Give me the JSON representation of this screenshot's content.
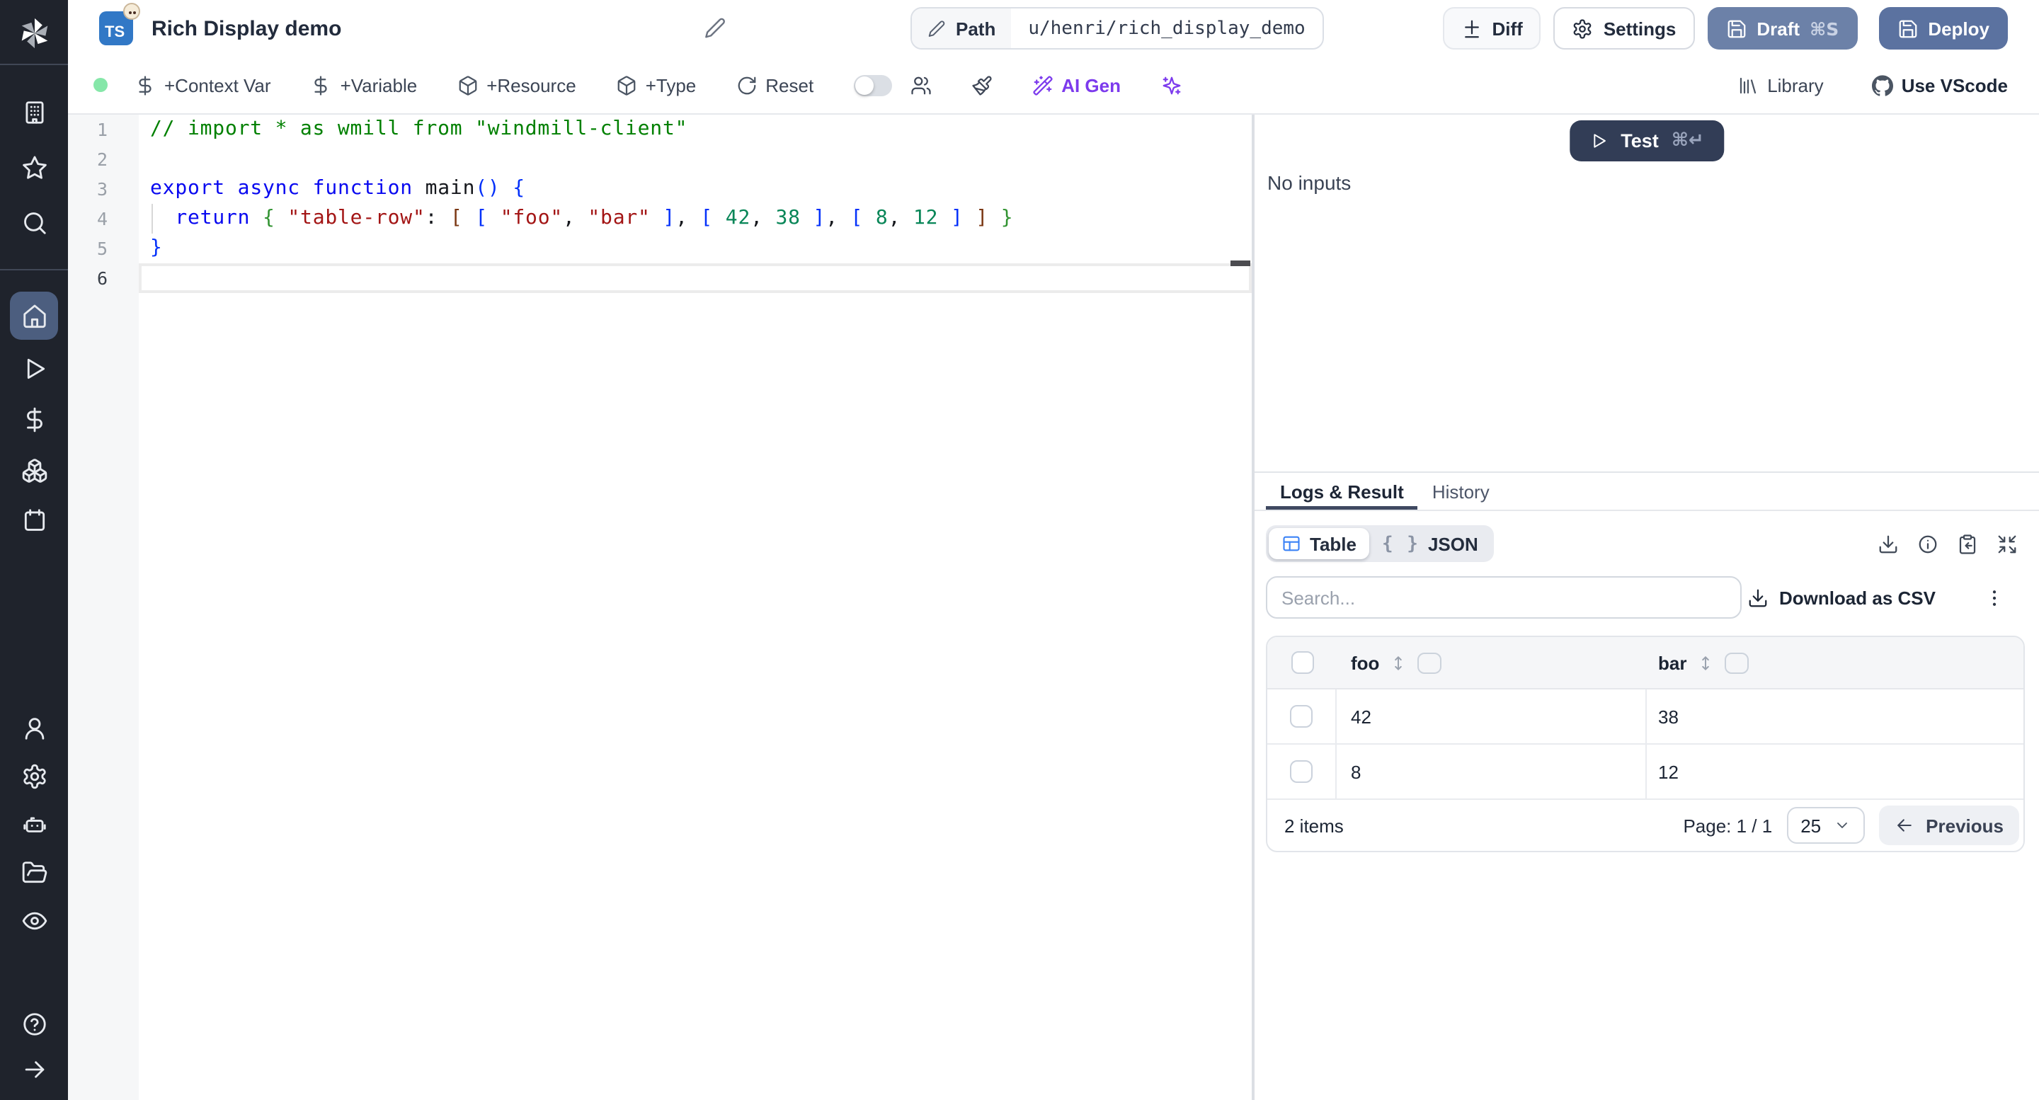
{
  "colors": {
    "sidebar_bg": "#1f232c",
    "active_nav_bg": "#4c5e7f",
    "draft_bg": "#6c81a8",
    "deploy_bg": "#5b72a0",
    "test_bg": "#323d56",
    "green_dot": "#86e7a9",
    "accent_purple": "#7c3aed",
    "table_icon_blue": "#3b82f6"
  },
  "icons_used": [
    "windmill-logo-icon",
    "building-icon",
    "star-icon",
    "search-icon",
    "home-icon",
    "play-icon",
    "dollar-icon",
    "boxes-icon",
    "calendar-icon",
    "user-icon",
    "gear-icon",
    "robot-icon",
    "folder-open-icon",
    "eye-icon",
    "help-icon",
    "arrow-right-icon",
    "pencil-icon",
    "diff-icon",
    "save-icon",
    "package-icon",
    "rotate-cw-icon",
    "users-icon",
    "paintbrush-icon",
    "wand-icon",
    "sparkles-icon",
    "library-icon",
    "github-icon",
    "table-icon",
    "braces-glyph",
    "download-icon",
    "info-icon",
    "clipboard-copy-icon",
    "expand-icon",
    "kebab-icon",
    "sort-icon",
    "chevron-down-icon",
    "arrow-left-icon"
  ],
  "header": {
    "badge": "TS",
    "title": "Rich Display demo",
    "path": {
      "label": "Path",
      "value": "u/henri/rich_display_demo"
    },
    "buttons": {
      "diff": "Diff",
      "settings": "Settings",
      "draft": "Draft",
      "draft_shortcut": "⌘S",
      "deploy": "Deploy"
    }
  },
  "toolbar": {
    "add_context_var": "+Context Var",
    "add_variable": "+Variable",
    "add_resource": "+Resource",
    "add_type": "+Type",
    "reset": "Reset",
    "ai_gen": "AI Gen",
    "library": "Library",
    "use_vscode": "Use VScode"
  },
  "editor": {
    "lines": [
      {
        "num": "1",
        "tokens": [
          [
            "comment",
            "// import * as wmill from \"windmill-client\""
          ]
        ]
      },
      {
        "num": "2",
        "tokens": []
      },
      {
        "num": "3",
        "tokens": [
          [
            "kw",
            "export"
          ],
          [
            "plain",
            " "
          ],
          [
            "kw",
            "async"
          ],
          [
            "plain",
            " "
          ],
          [
            "kw",
            "function"
          ],
          [
            "plain",
            " main"
          ],
          [
            "b1",
            "()"
          ],
          [
            "plain",
            " "
          ],
          [
            "b1",
            "{"
          ]
        ]
      },
      {
        "num": "4",
        "tokens": [
          [
            "plain",
            "  "
          ],
          [
            "kw",
            "return"
          ],
          [
            "plain",
            " "
          ],
          [
            "b2",
            "{"
          ],
          [
            "plain",
            " "
          ],
          [
            "str",
            "\"table-row\""
          ],
          [
            "plain",
            ": "
          ],
          [
            "b3",
            "["
          ],
          [
            "plain",
            " "
          ],
          [
            "b1",
            "["
          ],
          [
            "plain",
            " "
          ],
          [
            "str",
            "\"foo\""
          ],
          [
            "plain",
            ", "
          ],
          [
            "str",
            "\"bar\""
          ],
          [
            "plain",
            " "
          ],
          [
            "b1",
            "]"
          ],
          [
            "plain",
            ", "
          ],
          [
            "b1",
            "["
          ],
          [
            "plain",
            " "
          ],
          [
            "num",
            "42"
          ],
          [
            "plain",
            ", "
          ],
          [
            "num",
            "38"
          ],
          [
            "plain",
            " "
          ],
          [
            "b1",
            "]"
          ],
          [
            "plain",
            ", "
          ],
          [
            "b1",
            "["
          ],
          [
            "plain",
            " "
          ],
          [
            "num",
            "8"
          ],
          [
            "plain",
            ", "
          ],
          [
            "num",
            "12"
          ],
          [
            "plain",
            " "
          ],
          [
            "b1",
            "]"
          ],
          [
            "plain",
            " "
          ],
          [
            "b3",
            "]"
          ],
          [
            "plain",
            " "
          ],
          [
            "b2",
            "}"
          ]
        ]
      },
      {
        "num": "5",
        "tokens": [
          [
            "b1",
            "}"
          ]
        ]
      },
      {
        "num": "6",
        "tokens": [],
        "current": true
      }
    ]
  },
  "preview": {
    "test_label": "Test",
    "test_shortcut": "⌘↵",
    "no_inputs": "No inputs"
  },
  "tabs": {
    "logs_result": "Logs & Result",
    "history": "History"
  },
  "result": {
    "view_table": "Table",
    "view_json": "JSON",
    "json_braces_glyph": "{ }",
    "search_placeholder": "Search...",
    "download_csv": "Download as CSV",
    "columns": [
      "foo",
      "bar"
    ],
    "rows": [
      [
        "42",
        "38"
      ],
      [
        "8",
        "12"
      ]
    ],
    "items_label": "2 items",
    "page_label": "Page: 1 / 1",
    "page_size": "25",
    "previous_label": "Previous"
  }
}
